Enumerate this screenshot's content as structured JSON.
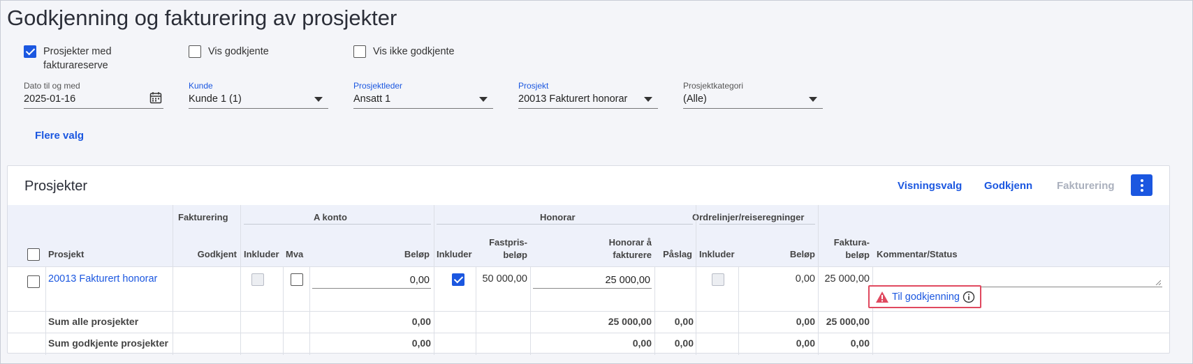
{
  "page": {
    "title": "Godkjenning og fakturering av prosjekter"
  },
  "filters": {
    "checkboxes": [
      {
        "label_line1": "Prosjekter med",
        "label_line2": "fakturareserve",
        "checked": true
      },
      {
        "label": "Vis godkjente",
        "checked": false
      },
      {
        "label": "Vis ikke godkjente",
        "checked": false
      }
    ],
    "date": {
      "label": "Dato til og med",
      "value": "2025-01-16",
      "icon": "calendar-icon"
    },
    "customer": {
      "label": "Kunde",
      "value": "Kunde 1 (1)"
    },
    "project_manager": {
      "label": "Prosjektleder",
      "value": "Ansatt 1"
    },
    "project": {
      "label": "Prosjekt",
      "value": "20013 Fakturert honorar"
    },
    "category": {
      "label": "Prosjektkategori",
      "value": "(Alle)"
    },
    "more_options": "Flere valg"
  },
  "card": {
    "title": "Prosjekter",
    "actions": {
      "view_options": "Visningsvalg",
      "approve": "Godkjenn",
      "invoicing": "Fakturering"
    },
    "more_icon": "more-vertical-icon"
  },
  "table": {
    "groups": {
      "fakturering": "Fakturering",
      "a_konto": "A konto",
      "honorar": "Honorar",
      "ordrelinjer": "Ordrelinjer/reiseregninger"
    },
    "columns": {
      "prosjekt": "Prosjekt",
      "godkjent": "Godkjent",
      "inkluder": "Inkluder",
      "mva": "Mva",
      "belop": "Beløp",
      "hon_inkluder": "Inkluder",
      "fastpris_1": "Fastpris-",
      "fastpris_2": "beløp",
      "hon_fakt_1": "Honorar å",
      "hon_fakt_2": "fakturere",
      "paslag": "Påslag",
      "ord_inkluder": "Inkluder",
      "ord_belop": "Beløp",
      "faktura_1": "Faktura-",
      "faktura_2": "beløp",
      "kommentar": "Kommentar/Status"
    },
    "row": {
      "project": "20013 Fakturert honorar",
      "a_konto_amount": "0,00",
      "honorar_included": true,
      "fastpris": "50 000,00",
      "honorar_fakturere": "25 000,00",
      "ord_belop": "0,00",
      "faktura_belop": "25 000,00",
      "status": "Til godkjenning",
      "status_icon": "warning-icon",
      "info_icon": "info-icon"
    },
    "sum_all": {
      "label": "Sum alle prosjekter",
      "a_konto": "0,00",
      "honorar": "25 000,00",
      "paslag": "0,00",
      "ord": "0,00",
      "faktura": "25 000,00"
    },
    "sum_approved": {
      "label": "Sum godkjente prosjekter",
      "a_konto": "0,00",
      "honorar": "0,00",
      "paslag": "0,00",
      "ord": "0,00",
      "faktura": "0,00"
    }
  },
  "colors": {
    "accent": "#1b57e0",
    "warning": "#e0495f",
    "header_bg": "#eef1fa"
  }
}
